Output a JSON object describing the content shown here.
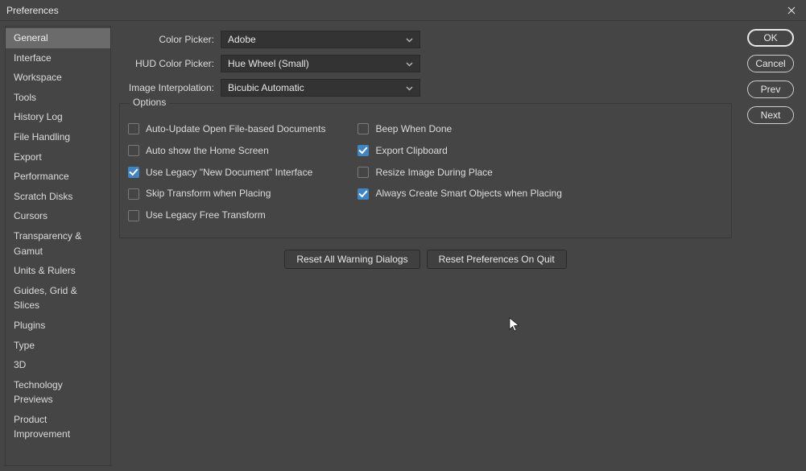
{
  "window": {
    "title": "Preferences"
  },
  "sidebar": {
    "items": [
      {
        "label": "General",
        "active": true
      },
      {
        "label": "Interface"
      },
      {
        "label": "Workspace"
      },
      {
        "label": "Tools"
      },
      {
        "label": "History Log"
      },
      {
        "label": "File Handling"
      },
      {
        "label": "Export"
      },
      {
        "label": "Performance"
      },
      {
        "label": "Scratch Disks"
      },
      {
        "label": "Cursors"
      },
      {
        "label": "Transparency & Gamut"
      },
      {
        "label": "Units & Rulers"
      },
      {
        "label": "Guides, Grid & Slices"
      },
      {
        "label": "Plugins"
      },
      {
        "label": "Type"
      },
      {
        "label": "3D"
      },
      {
        "label": "Technology Previews"
      },
      {
        "label": "Product Improvement"
      }
    ]
  },
  "form": {
    "color_picker": {
      "label": "Color Picker:",
      "value": "Adobe"
    },
    "hud_color_picker": {
      "label": "HUD Color Picker:",
      "value": "Hue Wheel (Small)"
    },
    "image_interpolation": {
      "label": "Image Interpolation:",
      "value": "Bicubic Automatic"
    }
  },
  "options": {
    "legend": "Options",
    "left": [
      {
        "label": "Auto-Update Open File-based Documents",
        "checked": false
      },
      {
        "label": "Auto show the Home Screen",
        "checked": false
      },
      {
        "label": "Use Legacy \"New Document\" Interface",
        "checked": true
      },
      {
        "label": "Skip Transform when Placing",
        "checked": false
      },
      {
        "label": "Use Legacy Free Transform",
        "checked": false
      }
    ],
    "right": [
      {
        "label": "Beep When Done",
        "checked": false
      },
      {
        "label": "Export Clipboard",
        "checked": true
      },
      {
        "label": "Resize Image During Place",
        "checked": false
      },
      {
        "label": "Always Create Smart Objects when Placing",
        "checked": true
      }
    ]
  },
  "buttons": {
    "reset_dialogs": "Reset All Warning Dialogs",
    "reset_prefs": "Reset Preferences On Quit"
  },
  "actions": {
    "ok": "OK",
    "cancel": "Cancel",
    "prev": "Prev",
    "next": "Next"
  }
}
